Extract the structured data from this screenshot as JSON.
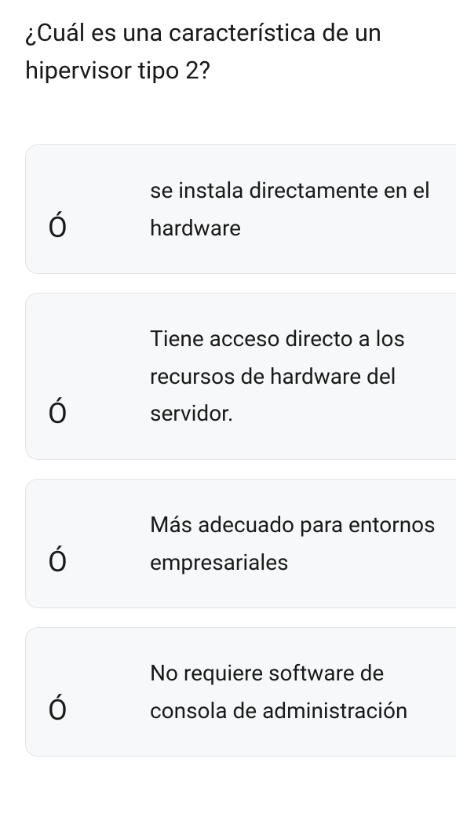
{
  "question": "¿Cuál es una característica de un hipervisor tipo 2?",
  "options": [
    {
      "marker": "Ó",
      "text": "se instala directamente en el hardware"
    },
    {
      "marker": "Ó",
      "text": "Tiene acceso directo a los recursos de hardware del servidor."
    },
    {
      "marker": "Ó",
      "text": "Más adecuado para entornos empresariales"
    },
    {
      "marker": "Ó",
      "text": "No requiere software de consola de administración"
    }
  ]
}
